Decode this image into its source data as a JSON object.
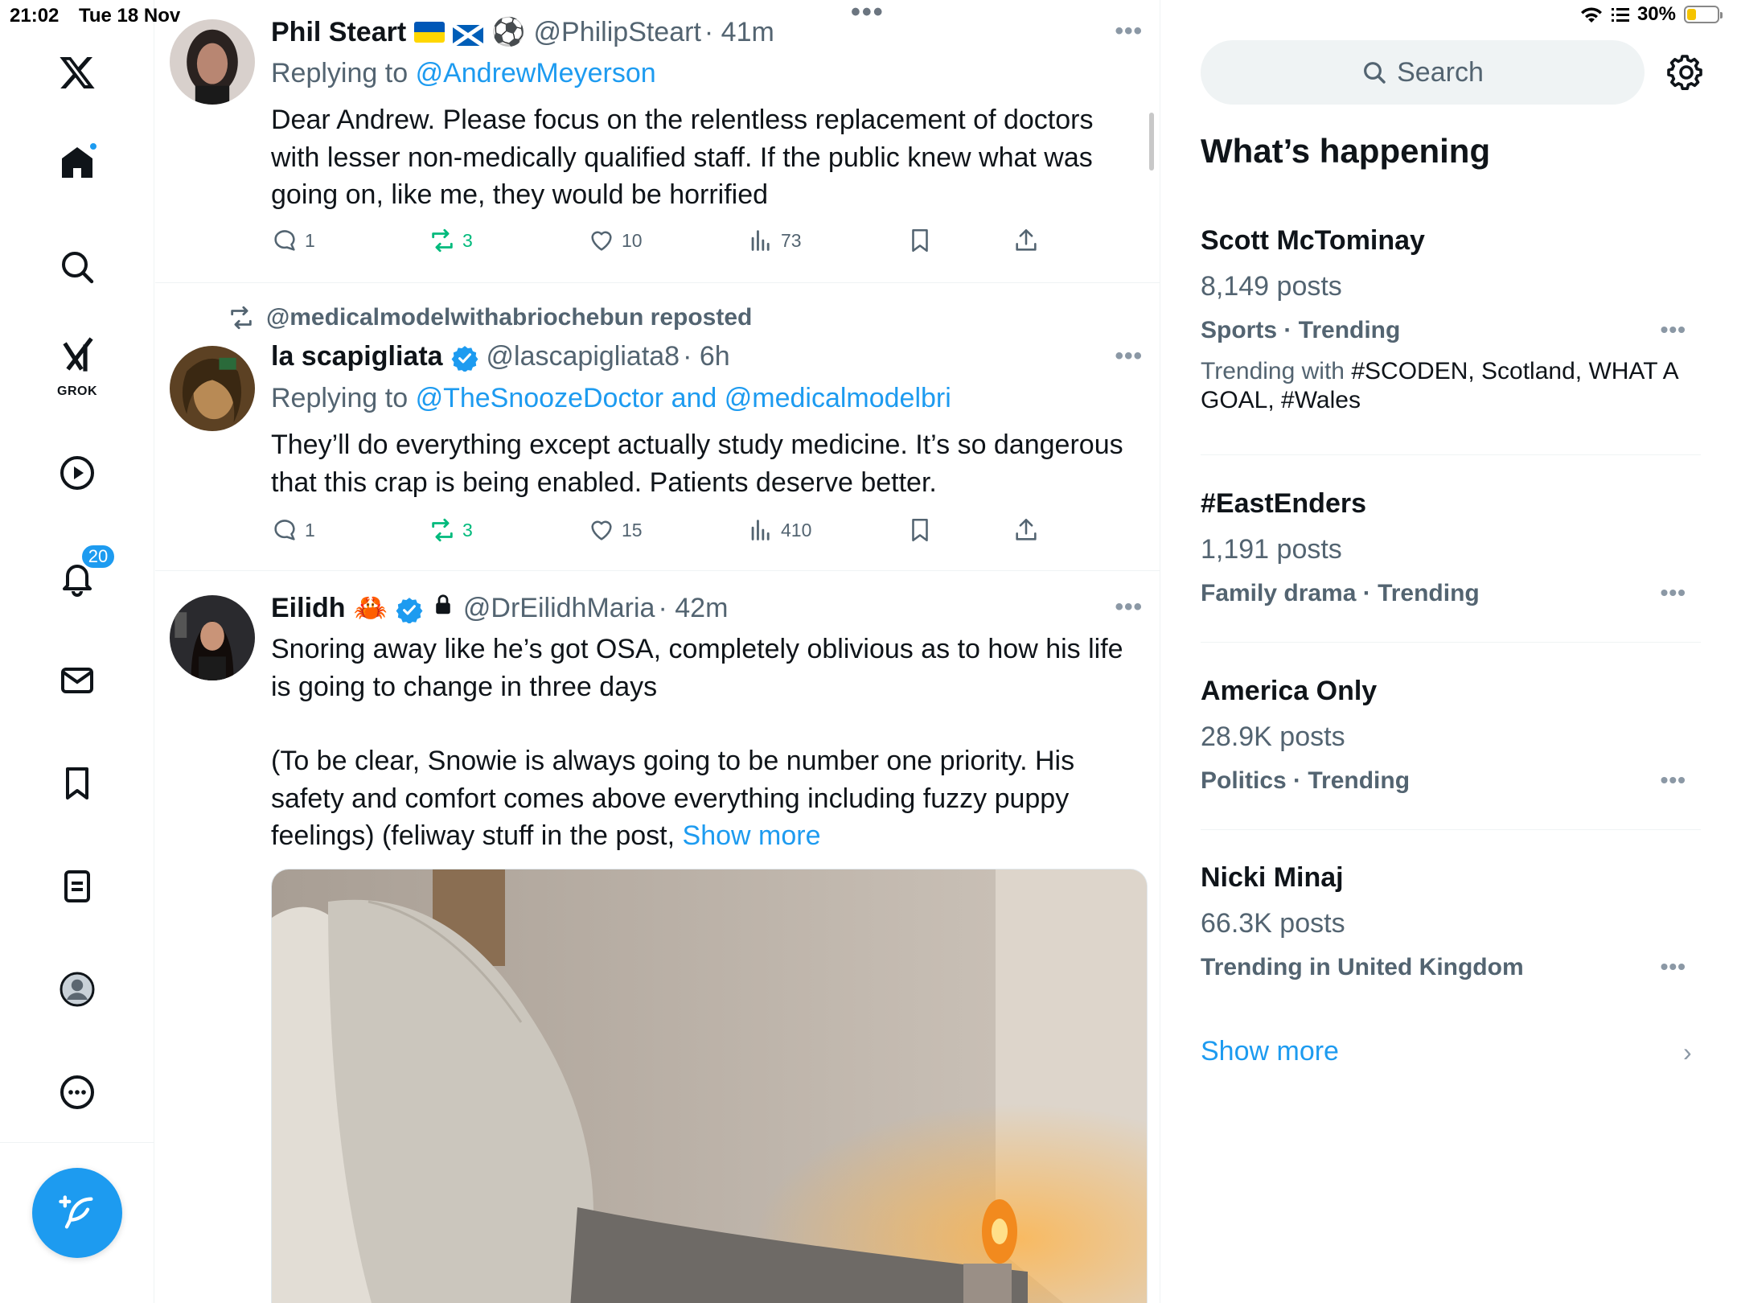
{
  "status": {
    "time": "21:02",
    "date": "Tue 18 Nov",
    "battery": "30%",
    "battery_level": 0.3
  },
  "nav": {
    "grok_label": "GROK",
    "notifications_count": "20",
    "items": [
      "home-icon",
      "search-icon",
      "grok-icon",
      "video-icon",
      "bell-icon",
      "mail-icon",
      "bookmark-icon",
      "lists-icon",
      "profile-icon",
      "more-icon"
    ]
  },
  "feed": {
    "tweets": [
      {
        "name": "Phil Steart",
        "handle": "@PhilipSteart",
        "time": "· 41m",
        "replying_prefix": "Replying to",
        "replying_to": "@AndrewMeyerson",
        "text": "Dear Andrew. Please focus on the relentless replacement of doctors with lesser non-medically qualified staff. If the public knew what was going on, like me, they would be horrified",
        "replies": "1",
        "reposts": "3",
        "likes": "10",
        "views": "73"
      },
      {
        "repost_by": "@medicalmodelwithabriochebun reposted",
        "name": "la scapigliata",
        "handle": "@lascapigliata8",
        "time": "· 6h",
        "replying_prefix": "Replying to",
        "replying_to": "@TheSnoozeDoctor and @medicalmodelbri",
        "text": "They’ll do everything except actually study medicine. It’s so dangerous that this crap is being enabled. Patients deserve better.",
        "replies": "1",
        "reposts": "3",
        "likes": "15",
        "views": "410"
      },
      {
        "name": "Eilidh",
        "handle": "@DrEilidhMaria",
        "time": "· 42m",
        "text_p1": "Snoring away like he’s got OSA, completely oblivious as to how his life is going to change in three days",
        "text_p2": "(To be clear, Snowie is always going to be number one priority. His safety and comfort comes above everything including fuzzy puppy feelings) (feliway stuff in the post,",
        "show_more": "Show more"
      }
    ]
  },
  "sidebar": {
    "search_placeholder": "Search",
    "whats_happening": "What’s happening",
    "trends": [
      {
        "name": "Scott McTominay",
        "posts": "8,149 posts",
        "category": "Sports · Trending",
        "trending_with_prefix": "Trending with",
        "trending_with": "#SCODEN, Scotland, WHAT A GOAL, #Wales"
      },
      {
        "name": "#EastEnders",
        "posts": "1,191 posts",
        "category": "Family drama · Trending"
      },
      {
        "name": "America Only",
        "posts": "28.9K posts",
        "category": "Politics · Trending"
      },
      {
        "name": "Nicki Minaj",
        "posts": "66.3K posts",
        "category": "Trending in United Kingdom"
      }
    ],
    "show_more": "Show more"
  },
  "colors": {
    "accent": "#1d9bf0",
    "repost_green": "#00ba7c",
    "muted": "#536471"
  }
}
